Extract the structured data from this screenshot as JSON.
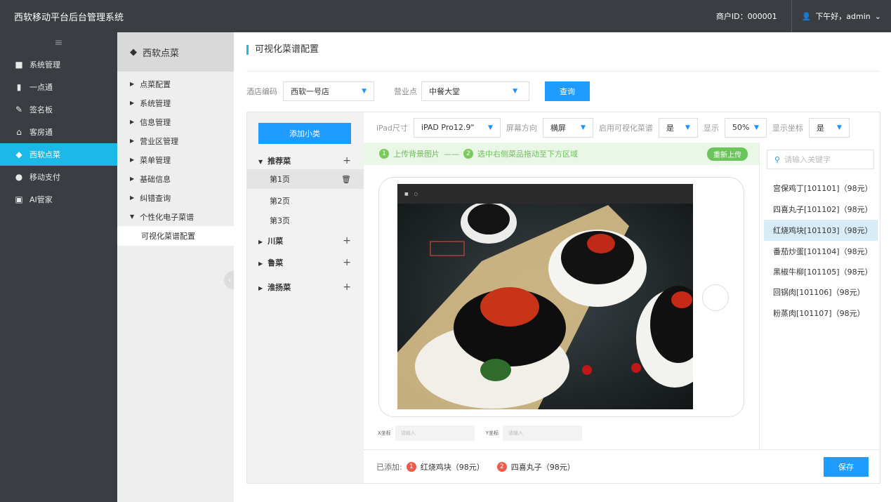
{
  "topbar": {
    "title": "西软移动平台后台管理系统",
    "merchant": "商户ID：000001",
    "greeting": "下午好，admin"
  },
  "sidebar": {
    "items": [
      {
        "label": "系统管理",
        "icon": "grid-icon"
      },
      {
        "label": "一点通",
        "icon": "bar-chart-icon"
      },
      {
        "label": "签名板",
        "icon": "pen-icon"
      },
      {
        "label": "客房通",
        "icon": "house-icon"
      },
      {
        "label": "西软点菜",
        "icon": "dish-icon"
      },
      {
        "label": "移动支付",
        "icon": "payment-icon"
      },
      {
        "label": "AI管家",
        "icon": "ai-icon"
      }
    ]
  },
  "subnav": {
    "header": "西软点菜",
    "items": [
      "点菜配置",
      "系统管理",
      "信息管理",
      "营业区管理",
      "菜单管理",
      "基础信息",
      "纠错查询",
      "个性化电子菜谱"
    ],
    "active_sub": "可视化菜谱配置"
  },
  "page": {
    "title": "可视化菜谱配置"
  },
  "filter": {
    "hotel_label": "酒店编码",
    "hotel_value": "西软一号店",
    "outlet_label": "营业点",
    "outlet_value": "中餐大堂",
    "query_button": "查询"
  },
  "tree": {
    "add_button": "添加小类",
    "groups": [
      {
        "name": "推荐菜",
        "expanded": true,
        "pages": [
          "第1页",
          "第2页",
          "第3页"
        ]
      },
      {
        "name": "川菜"
      },
      {
        "name": "鲁菜"
      },
      {
        "name": "淮扬菜"
      }
    ]
  },
  "toolbar": {
    "size_label": "iPad尺寸",
    "size_value": "iPAD Pro12.9\"",
    "orient_label": "屏幕方向",
    "orient_value": "横屏",
    "enable_label": "启用可视化菜谱",
    "enable_value": "是",
    "display_label": "显示",
    "display_value": "50%",
    "coord_label": "显示坐标",
    "coord_value": "是"
  },
  "tip": {
    "step1": "上传背景图片",
    "step2": "选中右侧菜品拖动至下方区域",
    "reupload": "重新上传"
  },
  "coords": {
    "x_label": "X坐标",
    "x_placeholder": "请输入",
    "y_label": "Y坐标",
    "y_placeholder": "请输入"
  },
  "dishes": {
    "search_placeholder": "请输入关键字",
    "list": [
      "宫保鸡丁[101101]（98元）",
      "四喜丸子[101102]（98元）",
      "红烧鸡块[101103]（98元）",
      "番茄炒蛋[101104]（98元）",
      "黑椒牛柳[101105]（98元）",
      "回锅肉[101106]（98元）",
      "粉蒸肉[101107]（98元）"
    ],
    "selected_index": 2
  },
  "added": {
    "label": "已添加:",
    "items": [
      {
        "num": "1",
        "name": "红烧鸡块（98元）"
      },
      {
        "num": "2",
        "name": "四喜丸子（98元）"
      }
    ]
  },
  "save_button": "保存",
  "colors": {
    "accent": "#1bb8e8",
    "primary_button": "#1e9bff",
    "dark": "#3a3d42"
  }
}
